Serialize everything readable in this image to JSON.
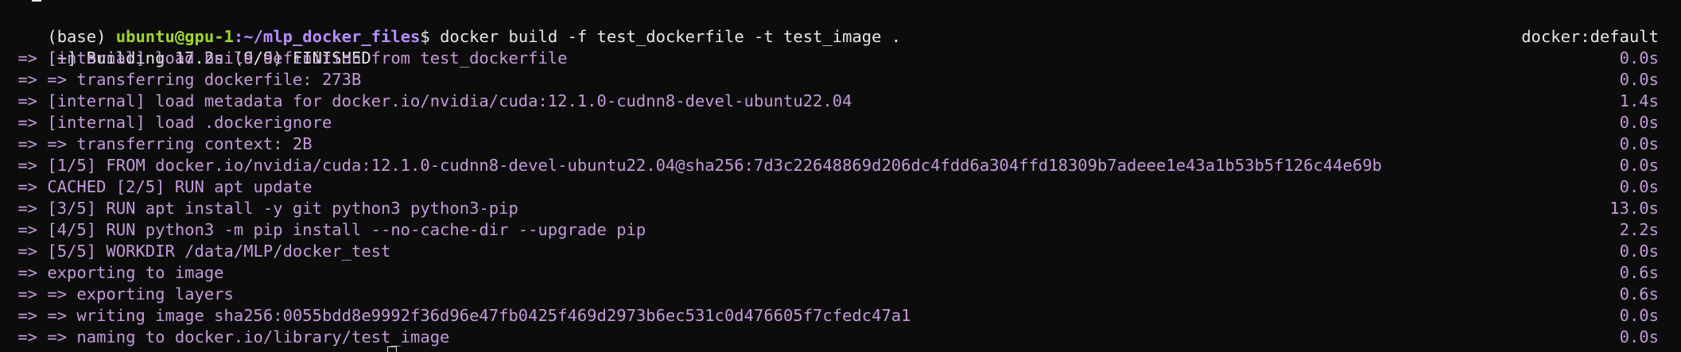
{
  "prompt": {
    "env": "(base) ",
    "user_host": "ubuntu@gpu-1",
    "path": ":~/mlp_docker_files",
    "symbol": "$ ",
    "command": "docker build -f test_dockerfile -t test_image ."
  },
  "build_header": {
    "text": "[+] Building 17.2s (9/9) FINISHED",
    "builder": "docker:default"
  },
  "steps": [
    {
      "text": " => [internal] load build definition from test_dockerfile",
      "time": "0.0s"
    },
    {
      "text": " => => transferring dockerfile: 273B",
      "time": "0.0s"
    },
    {
      "text": " => [internal] load metadata for docker.io/nvidia/cuda:12.1.0-cudnn8-devel-ubuntu22.04",
      "time": "1.4s"
    },
    {
      "text": " => [internal] load .dockerignore",
      "time": "0.0s"
    },
    {
      "text": " => => transferring context: 2B",
      "time": "0.0s"
    },
    {
      "text": " => [1/5] FROM docker.io/nvidia/cuda:12.1.0-cudnn8-devel-ubuntu22.04@sha256:7d3c22648869d206dc4fdd6a304ffd18309b7adeee1e43a1b53b5f126c44e69b",
      "time": "0.0s"
    },
    {
      "text": " => CACHED [2/5] RUN apt update",
      "time": "0.0s"
    },
    {
      "text": " => [3/5] RUN apt install -y git python3 python3-pip",
      "time": "13.0s"
    },
    {
      "text": " => [4/5] RUN python3 -m pip install --no-cache-dir --upgrade pip",
      "time": "2.2s"
    },
    {
      "text": " => [5/5] WORKDIR /data/MLP/docker_test",
      "time": "0.0s"
    },
    {
      "text": " => exporting to image",
      "time": "0.6s"
    },
    {
      "text": " => => exporting layers",
      "time": "0.6s"
    },
    {
      "text": " => => writing image sha256:0055bdd8e9992f36d96e47fb0425f469d2973b6ec531c0d476605f7cfedc47a1",
      "time": "0.0s"
    },
    {
      "text": " => => naming to docker.io/library/test_image",
      "time": "0.0s"
    }
  ],
  "colors": {
    "background": "#0c0c0c",
    "prompt_user": "#9fd62a",
    "prompt_path": "#b58cff",
    "step_text": "#c39ad9"
  }
}
